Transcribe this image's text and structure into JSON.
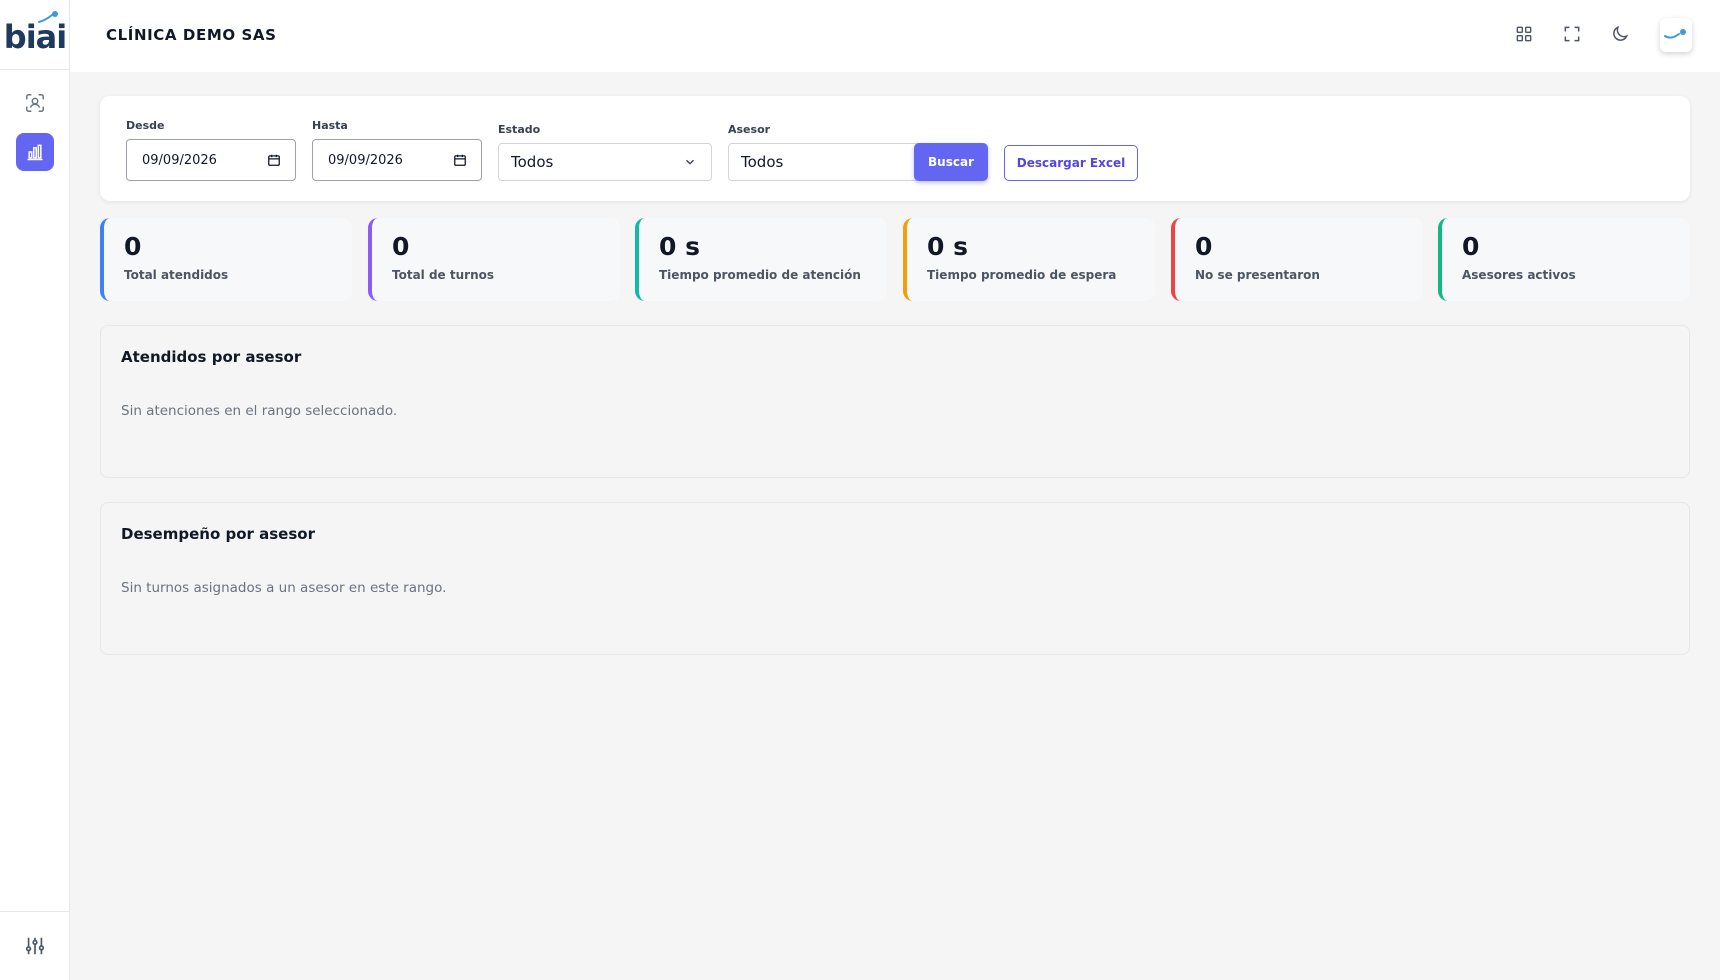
{
  "app": {
    "logo_text": "biai",
    "clinic_name": "CLÍNICA DEMO SAS"
  },
  "colors": {
    "accent": "#6366f1",
    "stat_blue": "#3b82f6",
    "stat_purple": "#8b5cf6",
    "stat_teal": "#14b8a6",
    "stat_orange": "#f59e0b",
    "stat_red": "#ef4444",
    "stat_green": "#10b981"
  },
  "sidebar": {
    "items": [
      {
        "icon": "face-scan-icon",
        "active": false
      },
      {
        "icon": "bar-chart-icon",
        "active": true
      }
    ],
    "bottom_icon": "sliders-icon"
  },
  "topbar": {
    "icons": [
      "apps-grid-icon",
      "fullscreen-icon",
      "dark-mode-icon"
    ],
    "avatar_icon": "user-avatar-icon"
  },
  "filters": {
    "desde_label": "Desde",
    "desde_value": "09/09/2026",
    "hasta_label": "Hasta",
    "hasta_value": "09/09/2026",
    "estado_label": "Estado",
    "estado_value": "Todos",
    "asesor_label": "Asesor",
    "asesor_value": "Todos",
    "buscar_label": "Buscar",
    "excel_label": "Descargar Excel"
  },
  "stats": [
    {
      "value": "0",
      "label": "Total atendidos"
    },
    {
      "value": "0",
      "label": "Total de turnos"
    },
    {
      "value": "0 s",
      "label": "Tiempo promedio de atención"
    },
    {
      "value": "0 s",
      "label": "Tiempo promedio de espera"
    },
    {
      "value": "0",
      "label": "No se presentaron"
    },
    {
      "value": "0",
      "label": "Asesores activos"
    }
  ],
  "panels": {
    "atendidos": {
      "title": "Atendidos por asesor",
      "empty": "Sin atenciones en el rango seleccionado."
    },
    "desempeno": {
      "title": "Desempeño por asesor",
      "empty": "Sin turnos asignados a un asesor en este rango."
    }
  }
}
